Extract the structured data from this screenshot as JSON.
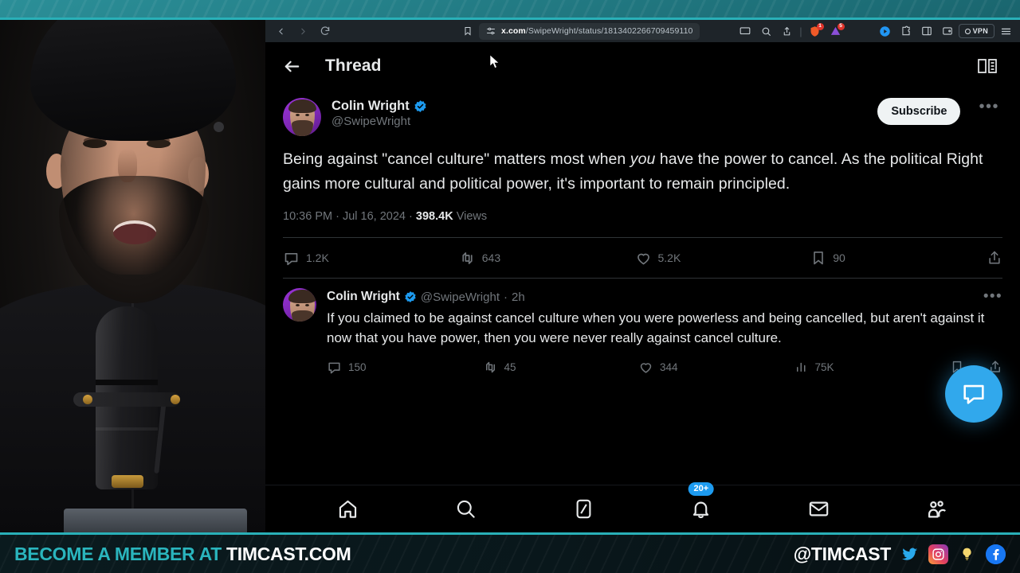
{
  "browser": {
    "url_host": "x.com",
    "url_path": "/SwipeWright/status/1813402266709459110",
    "back_icon": "back-arrow-icon",
    "forward_icon": "forward-arrow-icon",
    "reload_icon": "reload-icon",
    "bookmark_icon": "bookmark-icon",
    "site_settings_icon": "site-settings-icon",
    "extensions": [
      {
        "name": "split-screen-icon",
        "badge": ""
      },
      {
        "name": "zoom-search-icon",
        "badge": ""
      },
      {
        "name": "share-icon",
        "badge": ""
      },
      {
        "name": "brave-shields-icon",
        "badge": "1"
      },
      {
        "name": "notification-bell-icon",
        "badge": "5"
      },
      {
        "name": "player-icon",
        "badge": ""
      },
      {
        "name": "sidebar-panel-icon",
        "badge": ""
      },
      {
        "name": "reading-list-icon",
        "badge": ""
      },
      {
        "name": "wallet-icon",
        "badge": ""
      }
    ],
    "vpn_label": "VPN",
    "menu_icon": "hamburger-menu-icon"
  },
  "app": {
    "header": {
      "back_label": "back-arrow-icon",
      "title": "Thread",
      "reader_icon": "reader-mode-icon"
    },
    "main_tweet": {
      "display_name": "Colin Wright",
      "verified": true,
      "handle": "@SwipeWright",
      "subscribe_label": "Subscribe",
      "more_label": "•••",
      "body_part1": "Being against \"cancel culture\" matters most when ",
      "body_italic": "you",
      "body_part2": " have the power to cancel. As the political Right gains more cultural and political power, it's important to remain principled.",
      "time": "10:36 PM",
      "date": "Jul 16, 2024",
      "views_count": "398.4K",
      "views_label": "Views",
      "separator": "·",
      "actions": {
        "replies": "1.2K",
        "retweets": "643",
        "likes": "5.2K",
        "bookmarks": "90",
        "share": "share-icon"
      }
    },
    "reply_tweet": {
      "display_name": "Colin Wright",
      "verified": true,
      "handle": "@SwipeWright",
      "separator": "·",
      "timestamp": "2h",
      "more_label": "•••",
      "body": "If you claimed to be against cancel culture when you were powerless and being cancelled, but aren't against it now that you have power, then you were never really against cancel culture.",
      "actions": {
        "replies": "150",
        "retweets": "45",
        "likes": "344",
        "views": "75K",
        "bookmark": "bookmark-icon",
        "share": "share-icon"
      }
    },
    "bottom_nav": [
      {
        "name": "home",
        "icon": "home-icon",
        "badge": ""
      },
      {
        "name": "search",
        "icon": "search-icon",
        "badge": ""
      },
      {
        "name": "grok",
        "icon": "grok-icon",
        "badge": ""
      },
      {
        "name": "notifications",
        "icon": "notifications-icon",
        "badge": "20+"
      },
      {
        "name": "messages",
        "icon": "mail-icon",
        "badge": ""
      },
      {
        "name": "communities",
        "icon": "communities-icon",
        "badge": ""
      }
    ],
    "chat_fab": "chat-bubble-icon"
  },
  "banner": {
    "cta_prefix": "BECOME A MEMBER AT ",
    "cta_site": "TIMCAST.COM",
    "handle": "@TIMCAST",
    "socials": [
      "twitter-icon",
      "instagram-icon",
      "minds-bulb-icon",
      "facebook-icon"
    ]
  },
  "colors": {
    "accent_teal": "#29b0b8",
    "twitter_blue": "#1d9bf0",
    "verified_blue": "#1d9bf0",
    "text_primary": "#e7e9ea",
    "text_secondary": "#71767b"
  }
}
